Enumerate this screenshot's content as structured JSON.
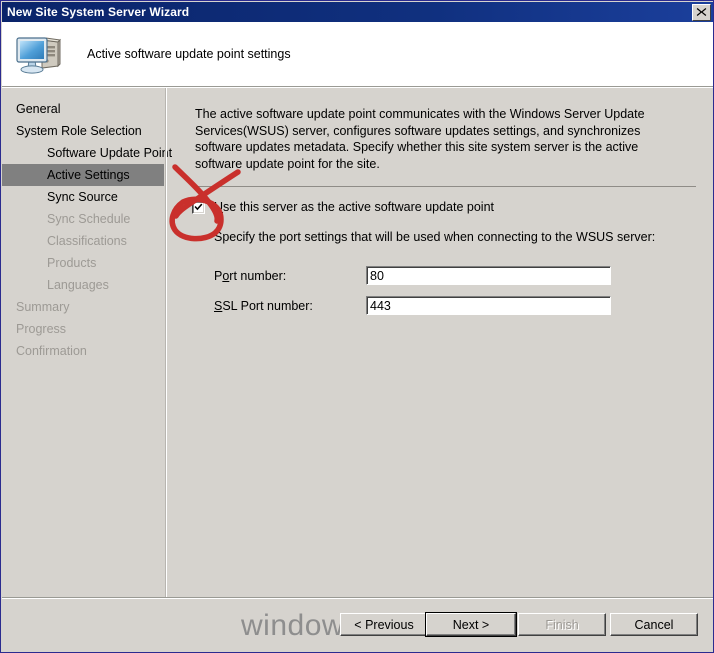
{
  "window": {
    "title": "New Site System Server Wizard",
    "close_label": "Close",
    "close_icon": "close-icon"
  },
  "header": {
    "icon": "computer-icon",
    "title": "Active software update point settings"
  },
  "sidebar": {
    "items": [
      {
        "label": "General",
        "indent": 0,
        "state": "normal"
      },
      {
        "label": "System Role Selection",
        "indent": 0,
        "state": "normal"
      },
      {
        "label": "Software Update Point",
        "indent": 1,
        "state": "normal"
      },
      {
        "label": "Active Settings",
        "indent": 1,
        "state": "selected"
      },
      {
        "label": "Sync Source",
        "indent": 2,
        "state": "normal"
      },
      {
        "label": "Sync Schedule",
        "indent": 2,
        "state": "dim"
      },
      {
        "label": "Classifications",
        "indent": 2,
        "state": "dim"
      },
      {
        "label": "Products",
        "indent": 2,
        "state": "dim"
      },
      {
        "label": "Languages",
        "indent": 2,
        "state": "dim"
      },
      {
        "label": "Summary",
        "indent": 0,
        "state": "dim"
      },
      {
        "label": "Progress",
        "indent": 0,
        "state": "dim"
      },
      {
        "label": "Confirmation",
        "indent": 0,
        "state": "dim"
      }
    ]
  },
  "content": {
    "description": "The active software update point communicates with the Windows Server Update Services(WSUS) server, configures software updates settings, and synchronizes software updates metadata. Specify whether this site system server is the active software update point for the site.",
    "checkbox": {
      "label_prefix": "U",
      "label_rest": "se this server as the active software update point",
      "checked": true
    },
    "port_intro": "Specify the port settings that will be used when connecting to the WSUS server:",
    "fields": [
      {
        "label_prefix": "P",
        "label_mid": "o",
        "label_rest": "rt number:",
        "value": "80"
      },
      {
        "label_prefix": "",
        "label_mid": "S",
        "label_rest": "SL Port number:",
        "value": "443"
      }
    ]
  },
  "annotation": {
    "type": "hand-drawn-red-circle-cross",
    "color": "#c9302c"
  },
  "footer": {
    "watermark": "windows-noob.com",
    "buttons": [
      {
        "id": "previous",
        "label": "< Previous",
        "state": "enabled"
      },
      {
        "id": "next",
        "label": "Next >",
        "state": "default"
      },
      {
        "id": "finish",
        "label": "Finish",
        "state": "disabled"
      },
      {
        "id": "cancel",
        "label": "Cancel",
        "state": "enabled"
      }
    ]
  },
  "colors": {
    "titlebar": "#0a246a",
    "face": "#d6d3ce",
    "selection": "#808080",
    "annotation_red": "#c9302c"
  }
}
